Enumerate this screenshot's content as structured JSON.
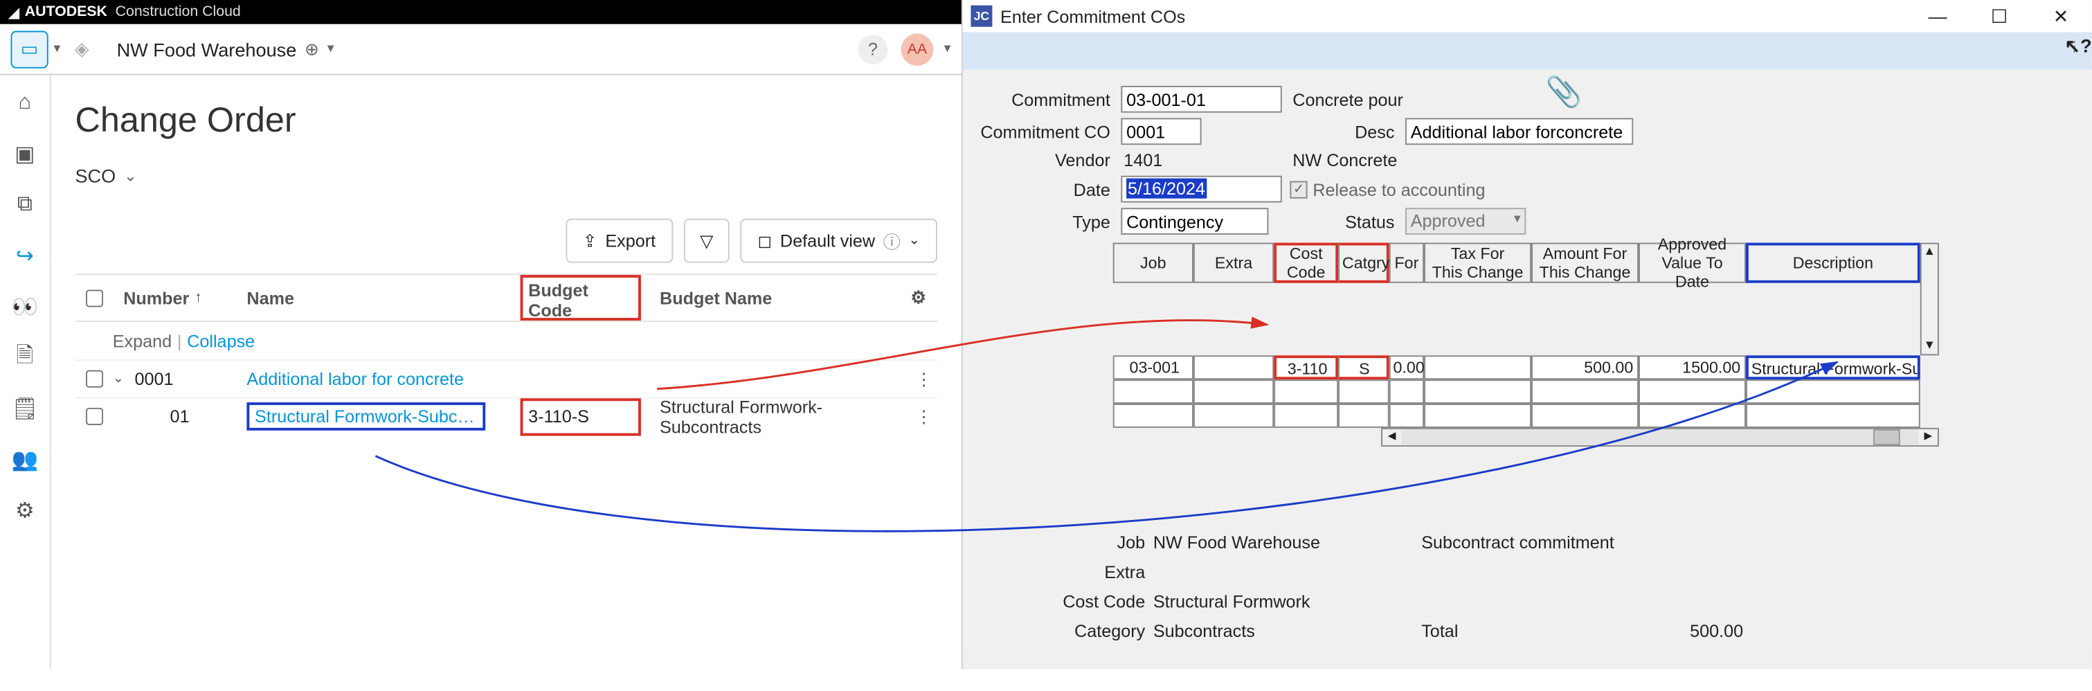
{
  "autodesk": {
    "brand": "AUTODESK",
    "product": "Construction Cloud"
  },
  "project_name": "NW Food Warehouse",
  "avatar_initials": "AA",
  "page_title": "Change Order",
  "sub_selector": "SCO",
  "toolbar": {
    "export_label": "Export",
    "default_view_label": "Default view"
  },
  "table": {
    "cols": {
      "number": "Number",
      "name": "Name",
      "budget_code": "Budget Code",
      "budget_name": "Budget Name"
    },
    "expand": "Expand",
    "collapse": "Collapse",
    "rows": {
      "group": {
        "number": "0001",
        "name": "Additional labor for concrete"
      },
      "item": {
        "number": "01",
        "name": "Structural Formwork-Subcontr...",
        "budget_code": "3-110-S",
        "budget_name": "Structural Formwork-Subcontracts"
      }
    }
  },
  "dialog": {
    "title": "Enter Commitment COs",
    "fields": {
      "commitment_label": "Commitment",
      "commitment_value": "03-001-01",
      "commitment_desc": "Concrete pour",
      "co_label": "Commitment CO",
      "co_value": "0001",
      "desc_label": "Desc",
      "desc_value": "Additional labor forconcrete",
      "vendor_label": "Vendor",
      "vendor_value": "1401",
      "vendor_name": "NW Concrete",
      "date_label": "Date",
      "date_value": "5/16/2024",
      "release_label": "Release to accounting",
      "type_label": "Type",
      "type_value": "Contingency",
      "status_label": "Status",
      "status_value": "Approved"
    },
    "grid": {
      "headers": {
        "job": "Job",
        "extra": "Extra",
        "cc": "Cost\nCode",
        "cat": "Catgry",
        "for": "For",
        "tax": "Tax For\nThis Change",
        "amt": "Amount For\nThis Change",
        "appr": "Approved\nValue To Date",
        "desc": "Description"
      },
      "row": {
        "job": "03-001",
        "extra": "",
        "cc": "3-110",
        "cat": "S",
        "for": "0.00",
        "tax": "",
        "amt": "500.00",
        "appr": "1500.00",
        "desc": "Structural Formwork-Subc"
      }
    },
    "summary": {
      "job_label": "Job",
      "job_val": "NW Food Warehouse",
      "extra_label": "Extra",
      "extra_val": "",
      "cc_label": "Cost Code",
      "cc_val": "Structural Formwork",
      "cat_label": "Category",
      "cat_val": "Subcontracts",
      "sub_label": "Subcontract commitment",
      "total_label": "Total",
      "total_val": "500.00"
    }
  }
}
